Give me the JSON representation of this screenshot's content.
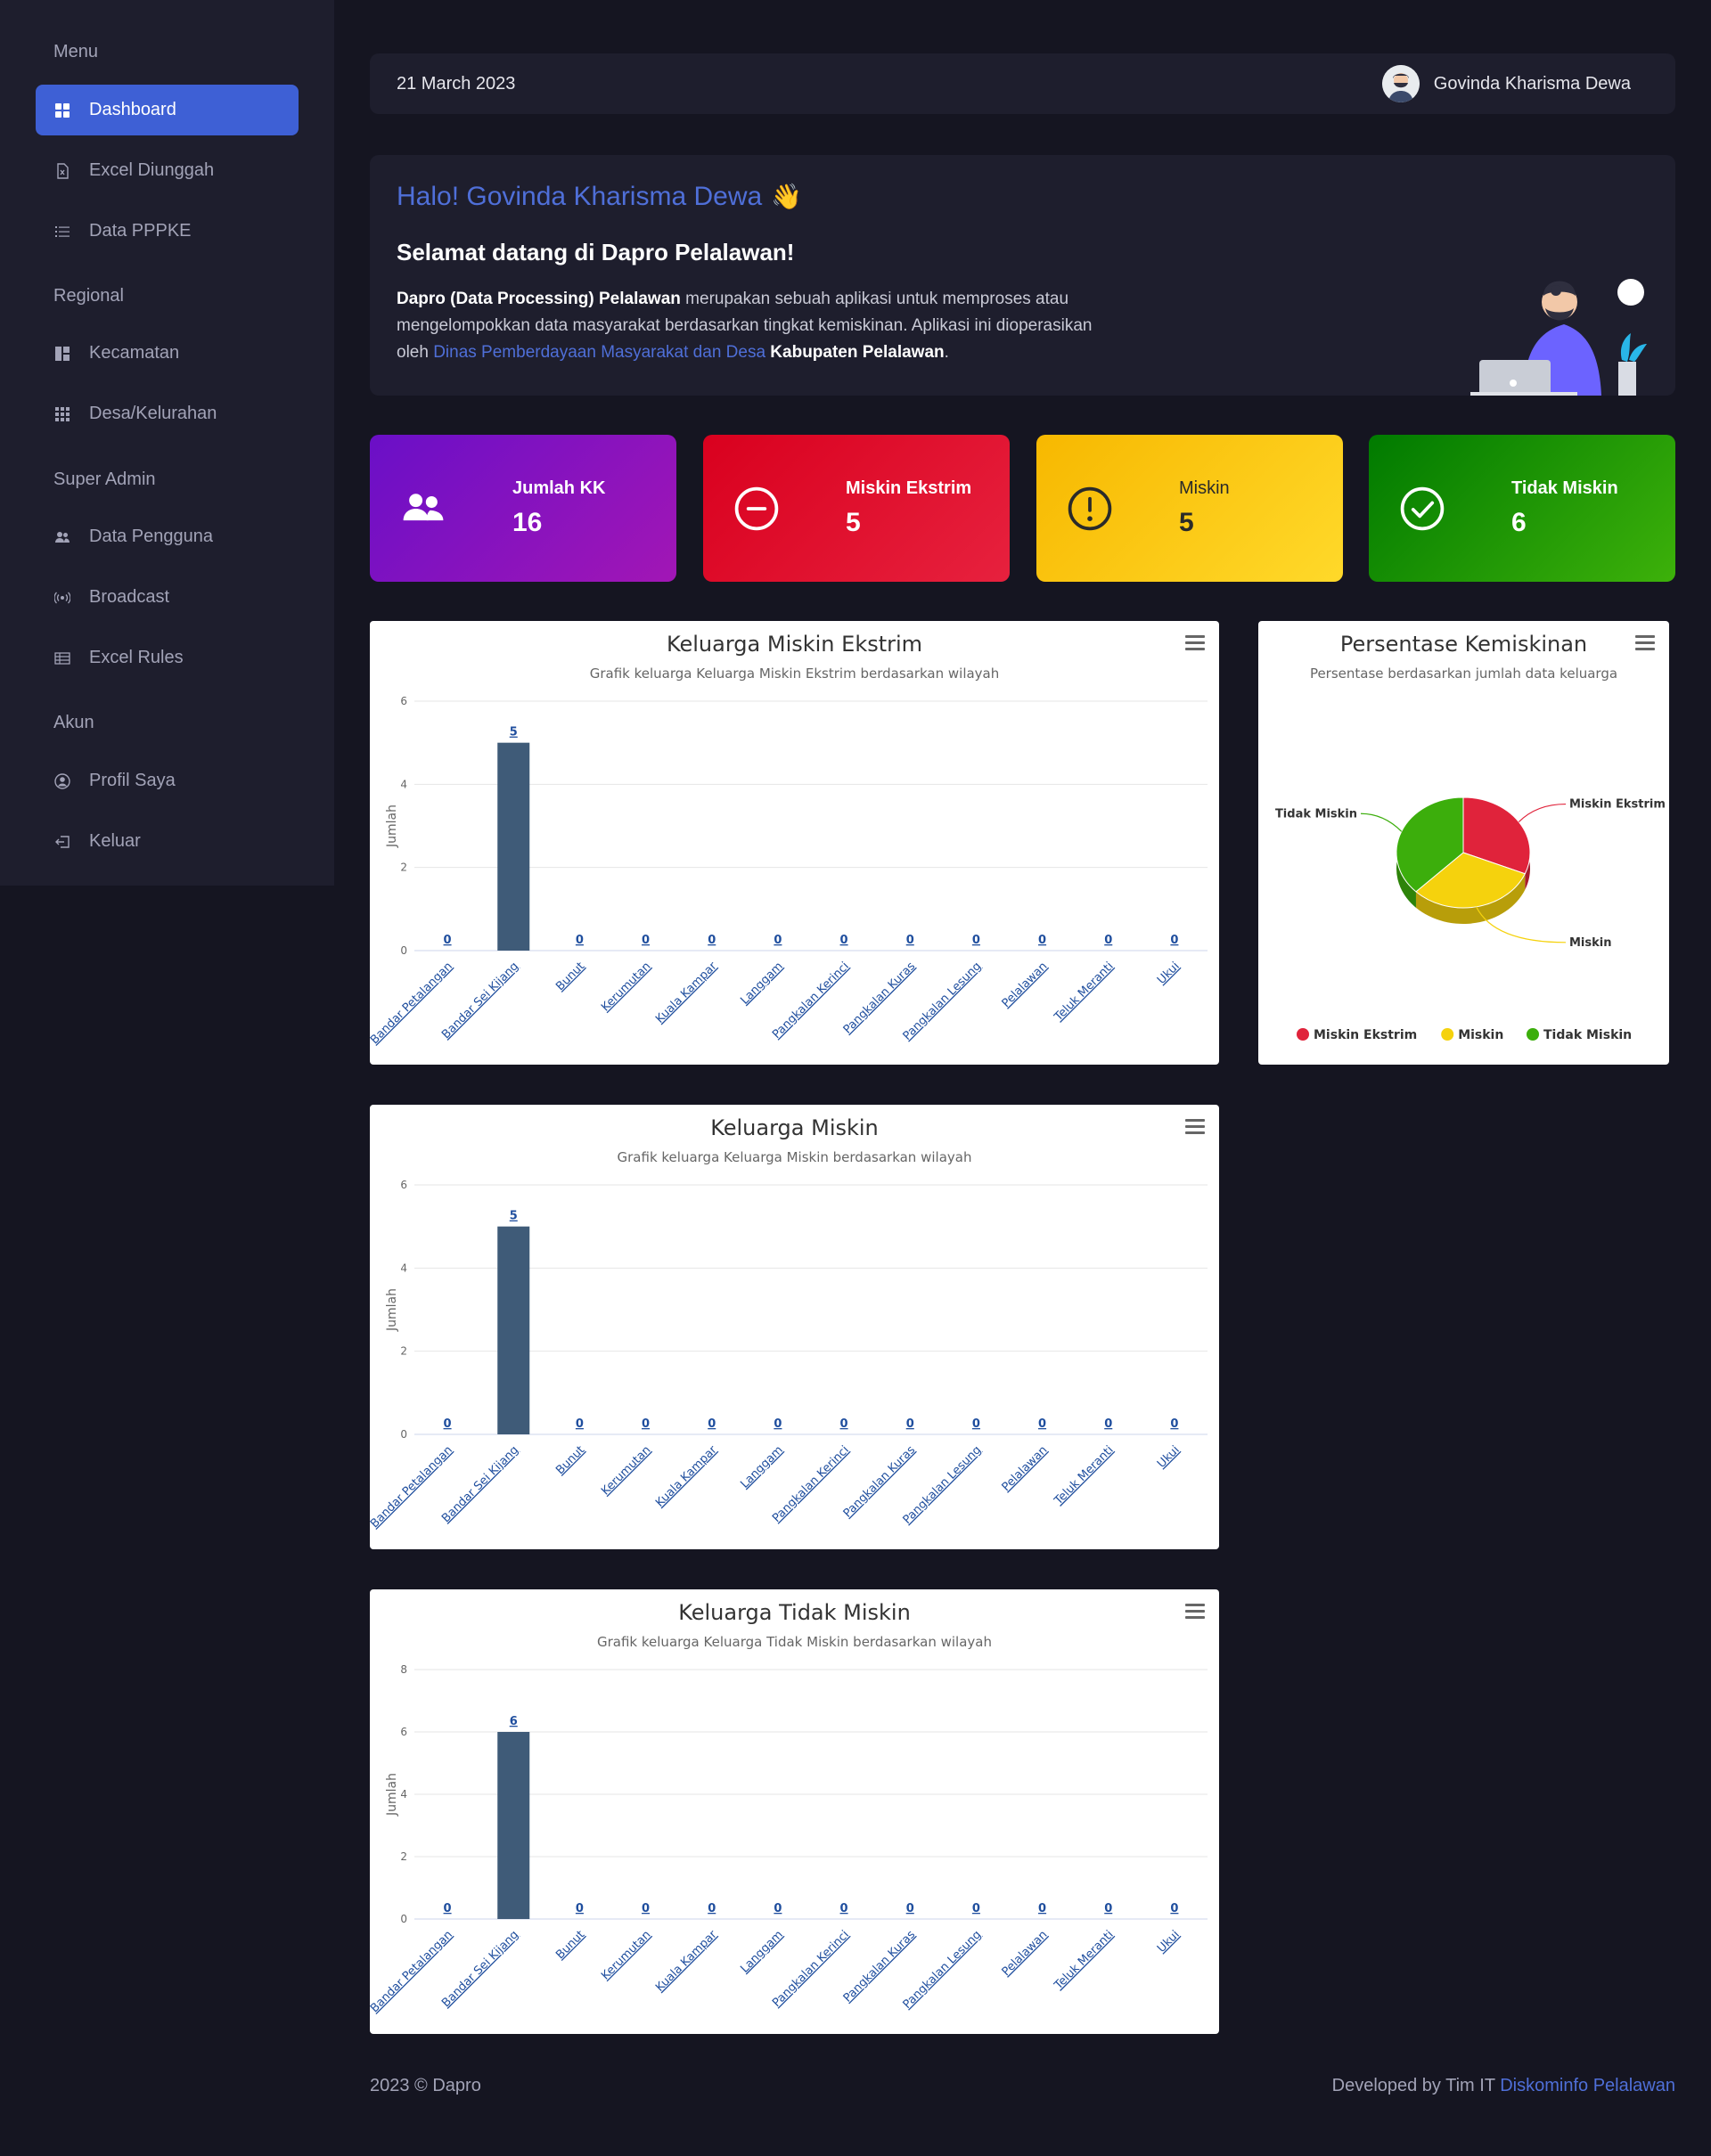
{
  "sidebar": {
    "sections": [
      "Menu",
      "Regional",
      "Super Admin",
      "Akun"
    ],
    "items": [
      {
        "label": "Dashboard",
        "icon": "dashboard-icon",
        "active": true
      },
      {
        "label": "Excel Diunggah",
        "icon": "file-excel-icon"
      },
      {
        "label": "Data PPPKE",
        "icon": "list-icon"
      },
      {
        "label": "Kecamatan",
        "icon": "layout-icon"
      },
      {
        "label": "Desa/Kelurahan",
        "icon": "grid-icon"
      },
      {
        "label": "Data Pengguna",
        "icon": "users-icon"
      },
      {
        "label": "Broadcast",
        "icon": "broadcast-icon"
      },
      {
        "label": "Excel Rules",
        "icon": "table-icon"
      },
      {
        "label": "Profil Saya",
        "icon": "user-circle-icon"
      },
      {
        "label": "Keluar",
        "icon": "logout-icon"
      }
    ]
  },
  "topbar": {
    "date": "21 March 2023",
    "user_name": "Govinda Kharisma Dewa"
  },
  "welcome": {
    "greeting": "Halo! Govinda Kharisma Dewa",
    "wave": "👋",
    "title": "Selamat datang di Dapro Pelalawan!",
    "text_bold1": "Dapro (Data Processing) Pelalawan",
    "text_part1": " merupakan sebuah aplikasi untuk memproses atau mengelompokkan data masyarakat berdasarkan tingkat kemiskinan. Aplikasi ini dioperasikan oleh ",
    "text_link": "Dinas Pemberdayaan Masyarakat dan Desa",
    "text_bold2": "Kabupaten Pelalawan",
    "text_end": "."
  },
  "stats": [
    {
      "label": "Jumlah KK",
      "value": "16",
      "icon": "users-icon",
      "color": "#7b10c3"
    },
    {
      "label": "Miskin Ekstrim",
      "value": "5",
      "icon": "minus-circle-icon",
      "color": "#e0102e"
    },
    {
      "label": "Miskin",
      "value": "5",
      "icon": "exclamation-circle-icon",
      "color": "#fcc50f"
    },
    {
      "label": "Tidak Miskin",
      "value": "6",
      "icon": "check-circle-icon",
      "color": "#1f9a05"
    }
  ],
  "chart_data": [
    {
      "type": "bar",
      "title": "Keluarga Miskin Ekstrim",
      "subtitle": "Grafik keluarga Keluarga Miskin Ekstrim berdasarkan wilayah",
      "ylabel": "Jumlah",
      "ylim": [
        0,
        6
      ],
      "yticks": [
        0,
        2,
        4,
        6
      ],
      "color": "#3f5b78",
      "categories": [
        "Bandar Petalangan",
        "Bandar Sei Kijang",
        "Bunut",
        "Kerumutan",
        "Kuala Kampar",
        "Langgam",
        "Pangkalan Kerinci",
        "Pangkalan Kuras",
        "Pangkalan Lesung",
        "Pelalawan",
        "Teluk Meranti",
        "Ukui"
      ],
      "values": [
        0,
        5,
        0,
        0,
        0,
        0,
        0,
        0,
        0,
        0,
        0,
        0
      ]
    },
    {
      "type": "bar",
      "title": "Keluarga Miskin",
      "subtitle": "Grafik keluarga Keluarga Miskin berdasarkan wilayah",
      "ylabel": "Jumlah",
      "ylim": [
        0,
        6
      ],
      "yticks": [
        0,
        2,
        4,
        6
      ],
      "color": "#3f5b78",
      "categories": [
        "Bandar Petalangan",
        "Bandar Sei Kijang",
        "Bunut",
        "Kerumutan",
        "Kuala Kampar",
        "Langgam",
        "Pangkalan Kerinci",
        "Pangkalan Kuras",
        "Pangkalan Lesung",
        "Pelalawan",
        "Teluk Meranti",
        "Ukui"
      ],
      "values": [
        0,
        5,
        0,
        0,
        0,
        0,
        0,
        0,
        0,
        0,
        0,
        0
      ]
    },
    {
      "type": "bar",
      "title": "Keluarga Tidak Miskin",
      "subtitle": "Grafik keluarga Keluarga Tidak Miskin berdasarkan wilayah",
      "ylabel": "Jumlah",
      "ylim": [
        0,
        8
      ],
      "yticks": [
        0,
        2,
        4,
        6,
        8
      ],
      "color": "#3f5b78",
      "categories": [
        "Bandar Petalangan",
        "Bandar Sei Kijang",
        "Bunut",
        "Kerumutan",
        "Kuala Kampar",
        "Langgam",
        "Pangkalan Kerinci",
        "Pangkalan Kuras",
        "Pangkalan Lesung",
        "Pelalawan",
        "Teluk Meranti",
        "Ukui"
      ],
      "values": [
        0,
        6,
        0,
        0,
        0,
        0,
        0,
        0,
        0,
        0,
        0,
        0
      ]
    },
    {
      "type": "pie",
      "title": "Persentase Kemiskinan",
      "subtitle": "Persentase berdasarkan jumlah data keluarga",
      "legend": "bottom",
      "slices": [
        {
          "name": "Miskin Ekstrim",
          "value": 5,
          "color": "#e0233b"
        },
        {
          "name": "Miskin",
          "value": 5,
          "color": "#f5d20d"
        },
        {
          "name": "Tidak Miskin",
          "value": 6,
          "color": "#3cae0c"
        }
      ]
    }
  ],
  "footer": {
    "left": "2023 © Dapro",
    "right_text": "Developed by Tim IT ",
    "right_link": "Diskominfo Pelalawan"
  }
}
